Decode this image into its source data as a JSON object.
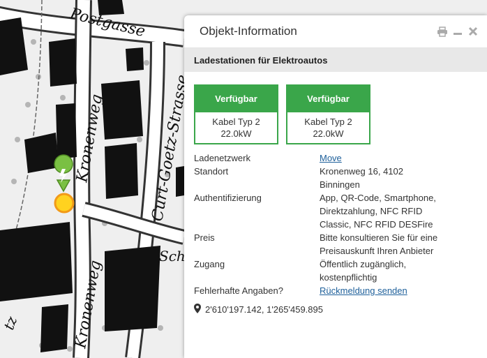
{
  "map": {
    "street_labels": [
      "Postgasse",
      "Kronenweg",
      "Curt-Goetz-Strasse",
      "Kronenweg",
      "Sch",
      "tz"
    ]
  },
  "popup": {
    "title": "Objekt-Information",
    "layer_name": "Ladestationen für Elektroautos",
    "stations": [
      {
        "status": "Verfügbar",
        "cable": "Kabel Typ 2",
        "power": "22.0kW"
      },
      {
        "status": "Verfügbar",
        "cable": "Kabel Typ 2",
        "power": "22.0kW"
      }
    ],
    "attributes": {
      "network_key": "Ladenetzwerk",
      "network_val": "Move",
      "location_key": "Standort",
      "location_val1": "Kronenweg 16, 4102",
      "location_val2": "Binningen",
      "auth_key": "Authentifizierung",
      "auth_val1": "App, QR-Code, Smartphone,",
      "auth_val2": "Direktzahlung, NFC RFID",
      "auth_val3": "Classic, NFC RFID DESFire",
      "price_key": "Preis",
      "price_val1": "Bitte konsultieren Sie für eine",
      "price_val2": "Preisauskunft Ihren Anbieter",
      "access_key": "Zugang",
      "access_val1": "Öffentlich zugänglich,",
      "access_val2": "kostenpflichtig",
      "error_key": "Fehlerhafte Angaben?",
      "error_link": "Rückmeldung senden"
    },
    "coordinates": "2'610'197.142, 1'265'459.895"
  },
  "colors": {
    "available_green": "#3aa64a",
    "marker_green": "#7ac043",
    "marker_yellow": "#ffd21f",
    "link_blue": "#1d5f9a"
  },
  "icons": {
    "print": "print-icon",
    "minimize": "minimize-icon",
    "close": "close-icon",
    "coordinate": "map-pin-icon",
    "marker": "charging-station-icon"
  }
}
